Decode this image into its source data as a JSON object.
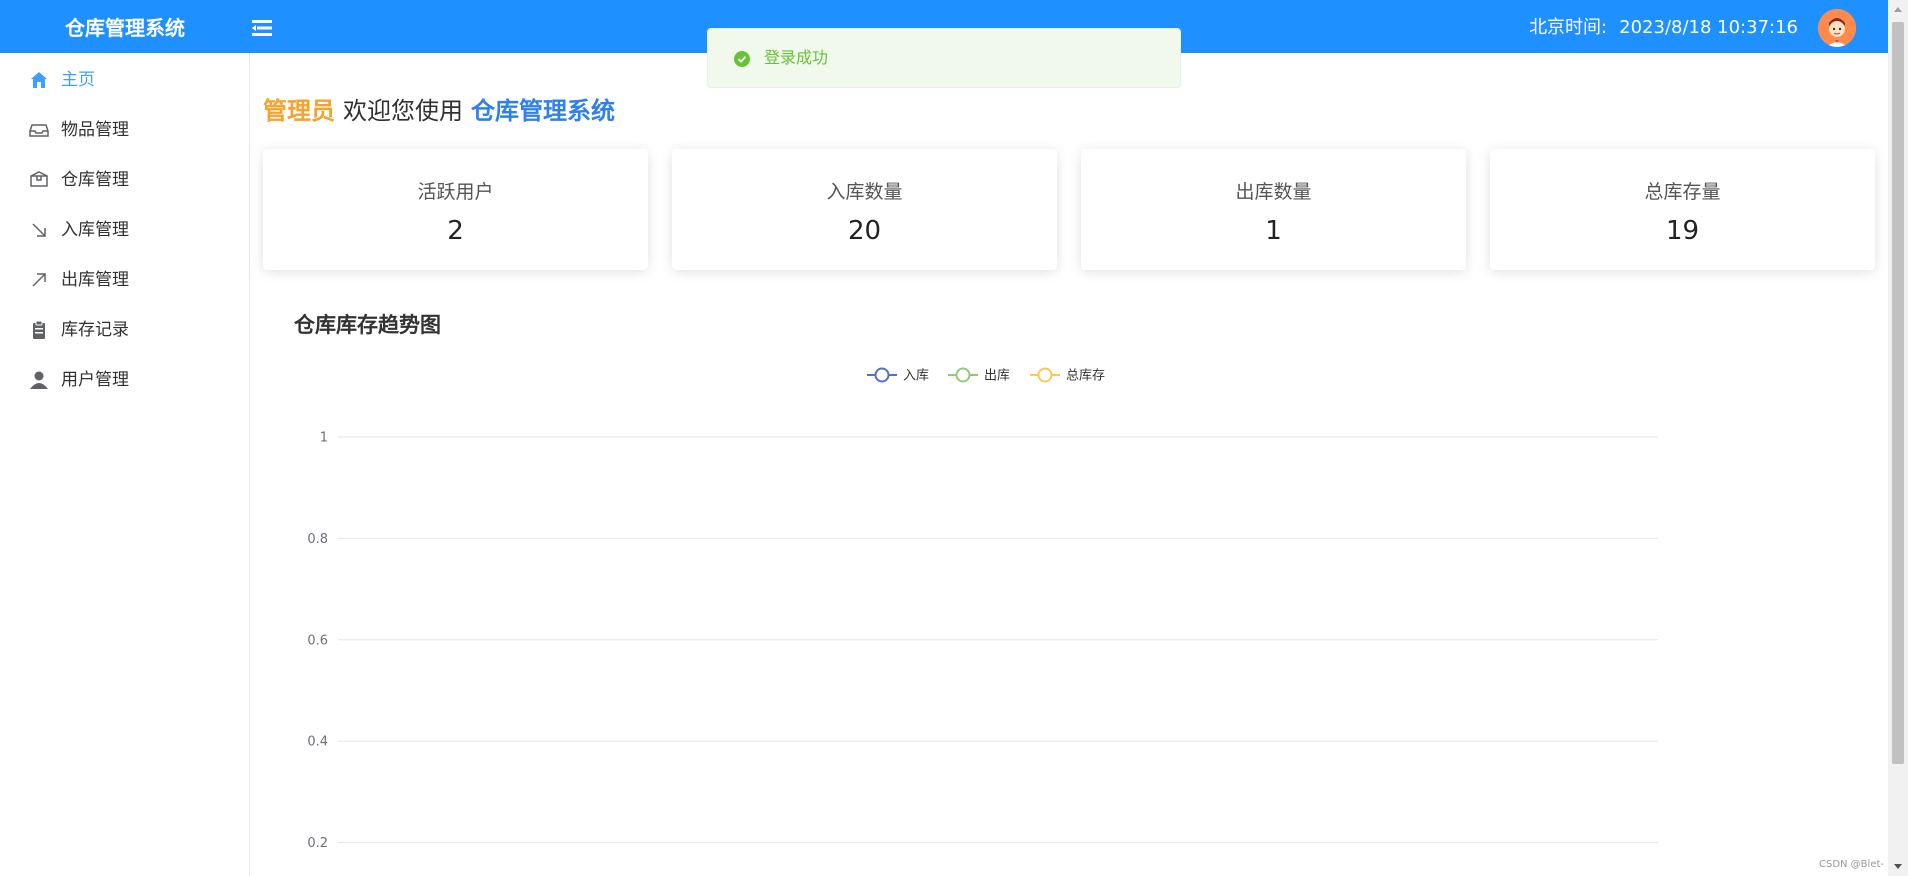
{
  "header": {
    "app_title": "仓库管理系统",
    "clock_label": "北京时间:",
    "clock_value": "2023/8/18 10:37:16"
  },
  "toast": {
    "message": "登录成功"
  },
  "sidebar": {
    "items": [
      {
        "label": "主页",
        "icon": "home-icon",
        "active": true
      },
      {
        "label": "物品管理",
        "icon": "inbox-icon"
      },
      {
        "label": "仓库管理",
        "icon": "box-icon"
      },
      {
        "label": "入库管理",
        "icon": "arrow-down-right-icon"
      },
      {
        "label": "出库管理",
        "icon": "arrow-up-right-icon"
      },
      {
        "label": "库存记录",
        "icon": "clipboard-icon"
      },
      {
        "label": "用户管理",
        "icon": "user-icon"
      }
    ]
  },
  "welcome": {
    "role": "管理员",
    "text": "欢迎您使用",
    "system": "仓库管理系统"
  },
  "stats": [
    {
      "title": "活跃用户",
      "value": "2"
    },
    {
      "title": "入库数量",
      "value": "20"
    },
    {
      "title": "出库数量",
      "value": "1"
    },
    {
      "title": "总库存量",
      "value": "19"
    }
  ],
  "chart_data": {
    "type": "line",
    "title": "仓库库存趋势图",
    "series": [
      {
        "name": "入库",
        "color": "#5470c6",
        "values": []
      },
      {
        "name": "出库",
        "color": "#91cc75",
        "values": []
      },
      {
        "name": "总库存",
        "color": "#fac858",
        "values": []
      }
    ],
    "y_ticks": [
      "1",
      "0.8",
      "0.6",
      "0.4",
      "0.2"
    ],
    "ylim": [
      0,
      1
    ],
    "grid": true,
    "legend_position": "top"
  },
  "watermark": "CSDN @Blet-"
}
